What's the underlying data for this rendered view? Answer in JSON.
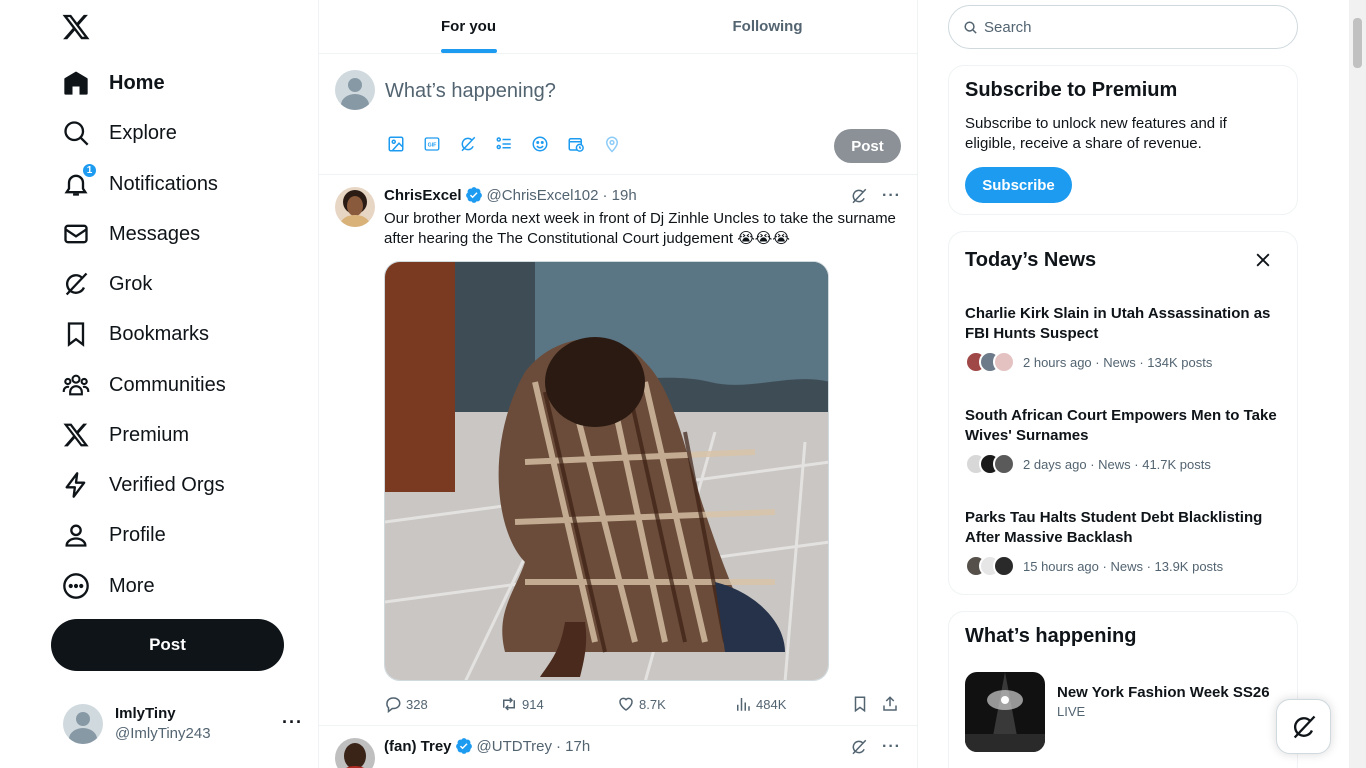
{
  "nav": {
    "items": [
      {
        "label": "Home",
        "icon": "home-icon",
        "active": true
      },
      {
        "label": "Explore",
        "icon": "search-icon"
      },
      {
        "label": "Notifications",
        "icon": "bell-icon",
        "badge": "1"
      },
      {
        "label": "Messages",
        "icon": "envelope-icon"
      },
      {
        "label": "Grok",
        "icon": "grok-icon"
      },
      {
        "label": "Bookmarks",
        "icon": "bookmark-icon"
      },
      {
        "label": "Communities",
        "icon": "communities-icon"
      },
      {
        "label": "Premium",
        "icon": "x-logo-icon"
      },
      {
        "label": "Verified Orgs",
        "icon": "lightning-icon"
      },
      {
        "label": "Profile",
        "icon": "person-icon"
      },
      {
        "label": "More",
        "icon": "more-circle-icon"
      }
    ],
    "post_label": "Post",
    "account": {
      "name": "ImlyTiny",
      "handle": "@ImlyTiny243"
    }
  },
  "timeline": {
    "tabs": [
      {
        "label": "For you",
        "active": true
      },
      {
        "label": "Following"
      }
    ],
    "composer": {
      "placeholder": "What’s happening?",
      "post_label": "Post"
    },
    "tweets": [
      {
        "name": "ChrisExcel",
        "handle": "@ChrisExcel102",
        "time": "· 19h",
        "text": "Our brother Morda next week in front of Dj Zinhle Uncles to take the surname after hearing the The Constitutional Court judgement 😭😭😭",
        "replies": "328",
        "reposts": "914",
        "likes": "8.7K",
        "views": "484K"
      },
      {
        "name": "(fan) Trey",
        "handle": "@UTDTrey",
        "time": "· 17h"
      }
    ]
  },
  "sidebar": {
    "search_placeholder": "Search",
    "premium": {
      "title": "Subscribe to Premium",
      "desc": "Subscribe to unlock new features and if eligible, receive a share of revenue.",
      "button": "Subscribe"
    },
    "news": {
      "title": "Today’s News",
      "items": [
        {
          "title": "Charlie Kirk Slain in Utah Assassination as FBI Hunts Suspect",
          "meta": "2 hours ago · News · 134K posts"
        },
        {
          "title": "South African Court Empowers Men to Take Wives' Surnames",
          "meta": "2 days ago · News · 41.7K posts"
        },
        {
          "title": "Parks Tau Halts Student Debt Blacklisting After Massive Backlash",
          "meta": "15 hours ago · News · 13.9K posts"
        }
      ]
    },
    "happening": {
      "title": "What’s happening",
      "item_title": "New York Fashion Week SS26",
      "item_status": "LIVE"
    }
  }
}
